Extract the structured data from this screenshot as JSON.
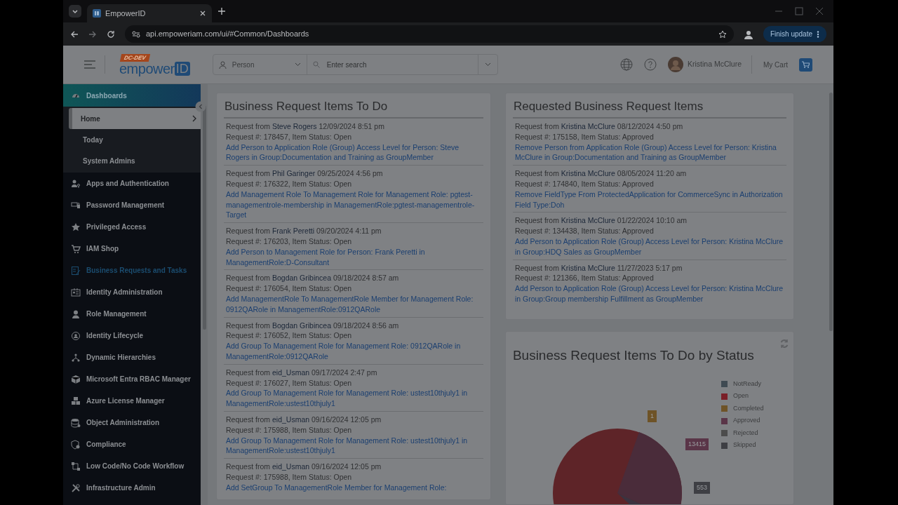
{
  "browser": {
    "tabs": [
      {
        "title": "EmpowerID",
        "selected": true
      }
    ],
    "url": "api.empoweriam.com/ui/#Common/Dashboards",
    "update_button": "Finish update"
  },
  "header": {
    "logo": {
      "badge": "DC-DEV",
      "word": "empower",
      "boxed": "ID"
    },
    "search_type": "Person",
    "search_placeholder": "Enter search",
    "user_name": "Kristina McClure",
    "cart_label": "My Cart"
  },
  "sidebar": {
    "items": [
      {
        "label": "Dashboards",
        "expanded": true,
        "hovered": false,
        "children": [
          {
            "label": "Home",
            "selected": true
          },
          {
            "label": "Today",
            "selected": false
          },
          {
            "label": "System Admins",
            "selected": false
          }
        ]
      },
      {
        "label": "Apps and Authentication",
        "expanded": false,
        "hovered": false
      },
      {
        "label": "Password Management",
        "expanded": false,
        "hovered": false
      },
      {
        "label": "Privileged Access",
        "expanded": false,
        "hovered": false
      },
      {
        "label": "IAM Shop",
        "expanded": false,
        "hovered": false
      },
      {
        "label": "Business Requests and Tasks",
        "expanded": false,
        "hovered": true
      },
      {
        "label": "Identity Administration",
        "expanded": false,
        "hovered": false
      },
      {
        "label": "Role Management",
        "expanded": false,
        "hovered": false
      },
      {
        "label": "Identity Lifecycle",
        "expanded": false,
        "hovered": false
      },
      {
        "label": "Dynamic Hierarchies",
        "expanded": false,
        "hovered": false
      },
      {
        "label": "Microsoft Entra RBAC Manager",
        "expanded": false,
        "hovered": false
      },
      {
        "label": "Azure License Manager",
        "expanded": false,
        "hovered": false
      },
      {
        "label": "Object Administration",
        "expanded": false,
        "hovered": false
      },
      {
        "label": "Compliance",
        "expanded": false,
        "hovered": false
      },
      {
        "label": "Low Code/No Code Workflow",
        "expanded": false,
        "hovered": false
      },
      {
        "label": "Infrastructure Admin",
        "expanded": false,
        "hovered": false
      }
    ]
  },
  "todo_card": {
    "title": "Business Request Items To Do",
    "items": [
      {
        "prefix": "Request from",
        "requester": "Steve Rogers",
        "when": "12/09/2024 8:51 pm",
        "status_line": "Request #: 178457, Item Status: Open",
        "link": "Add Person to Application Role (Group) Access Level for Person: Steve Rogers in Group:Documentation and Training as GroupMember"
      },
      {
        "prefix": "Request from",
        "requester": "Phil Garinger",
        "when": "09/25/2024 4:56 pm",
        "status_line": "Request #: 176322, Item Status: Open",
        "link": "Add Management Role To Management Role for Management Role: pgtest-managementrole-membership in ManagementRole:pgtest-managementrole-Target"
      },
      {
        "prefix": "Request from",
        "requester": "Frank Peretti",
        "when": "09/20/2024 4:11 pm",
        "status_line": "Request #: 176203, Item Status: Open",
        "link": "Add Person to Management Role for Person: Frank Peretti in ManagementRole:D-Consultant"
      },
      {
        "prefix": "Request from",
        "requester": "Bogdan Gribincea",
        "when": "09/18/2024 8:57 am",
        "status_line": "Request #: 176054, Item Status: Open",
        "link": "Add ManagementRole To ManagementRole Member for Management Role: 0912QARole in ManagementRole:0912QARole"
      },
      {
        "prefix": "Request from",
        "requester": "Bogdan Gribincea",
        "when": "09/18/2024 8:56 am",
        "status_line": "Request #: 176052, Item Status: Open",
        "link": "Add Group To Management Role for Management Role: 0912QARole in ManagementRole:0912QARole"
      },
      {
        "prefix": "Request from",
        "requester": "eid_Usman",
        "when": "09/17/2024 2:47 pm",
        "status_line": "Request #: 176027, Item Status: Open",
        "link": "Add Group To Management Role for Management Role: ustest10thjuly1 in ManagementRole:ustest10thjuly1"
      },
      {
        "prefix": "Request from",
        "requester": "eid_Usman",
        "when": "09/16/2024 12:05 pm",
        "status_line": "Request #: 175988, Item Status: Open",
        "link": "Add Group To Management Role for Management Role: ustest10thjuly1 in ManagementRole:ustest10thjuly1"
      },
      {
        "prefix": "Request from",
        "requester": "eid_Usman",
        "when": "09/16/2024 12:05 pm",
        "status_line": "Request #: 175988, Item Status: Open",
        "link": "Add SetGroup To ManagementRole Member for Management Role:"
      }
    ]
  },
  "requested_card": {
    "title": "Requested Business Request Items",
    "items": [
      {
        "prefix": "Request from",
        "requester": "Kristina McClure",
        "when": "08/12/2024 4:50 pm",
        "status_line": "Request #: 175158, Item Status: Approved",
        "link": "Remove Person from Application Role (Group) Access Level for Person: Kristina McClure in Group:Documentation and Training as GroupMember"
      },
      {
        "prefix": "Request from",
        "requester": "Kristina McClure",
        "when": "08/05/2024 11:20 am",
        "status_line": "Request #: 174840, Item Status: Approved",
        "link": "Remove FieldType From ProtectedApplication for CommerceSync in Authorization Field Type:Doh"
      },
      {
        "prefix": "Request from",
        "requester": "Kristina McClure",
        "when": "01/22/2024 10:10 am",
        "status_line": "Request #: 134438, Item Status: Approved",
        "link": "Add Person to Application Role (Group) Access Level for Person: Kristina McClure in Group:HDQ Sales as GroupMember"
      },
      {
        "prefix": "Request from",
        "requester": "Kristina McClure",
        "when": "11/27/2023 5:17 pm",
        "status_line": "Request #: 121366, Item Status: Approved",
        "link": "Add Person to Application Role (Group) Access Level for Person: Kristina McClure in Group:Group membership Fulfillment as GroupMember"
      }
    ]
  },
  "chart_card": {
    "title": "Business Request Items To Do by Status",
    "legend": [
      {
        "label": "NotReady",
        "color": "#3f4a52"
      },
      {
        "label": "Open",
        "color": "#7a1f28"
      },
      {
        "label": "Completed",
        "color": "#6e5327"
      },
      {
        "label": "Approved",
        "color": "#5a3548"
      },
      {
        "label": "Rejected",
        "color": "#4c4c4c"
      },
      {
        "label": "Skipped",
        "color": "#3e3f44"
      }
    ],
    "callouts": [
      {
        "text": "1",
        "color": "#6e5327"
      },
      {
        "text": "13415",
        "color": "#5a3548"
      },
      {
        "text": "553",
        "color": "#3e3f44"
      }
    ]
  }
}
